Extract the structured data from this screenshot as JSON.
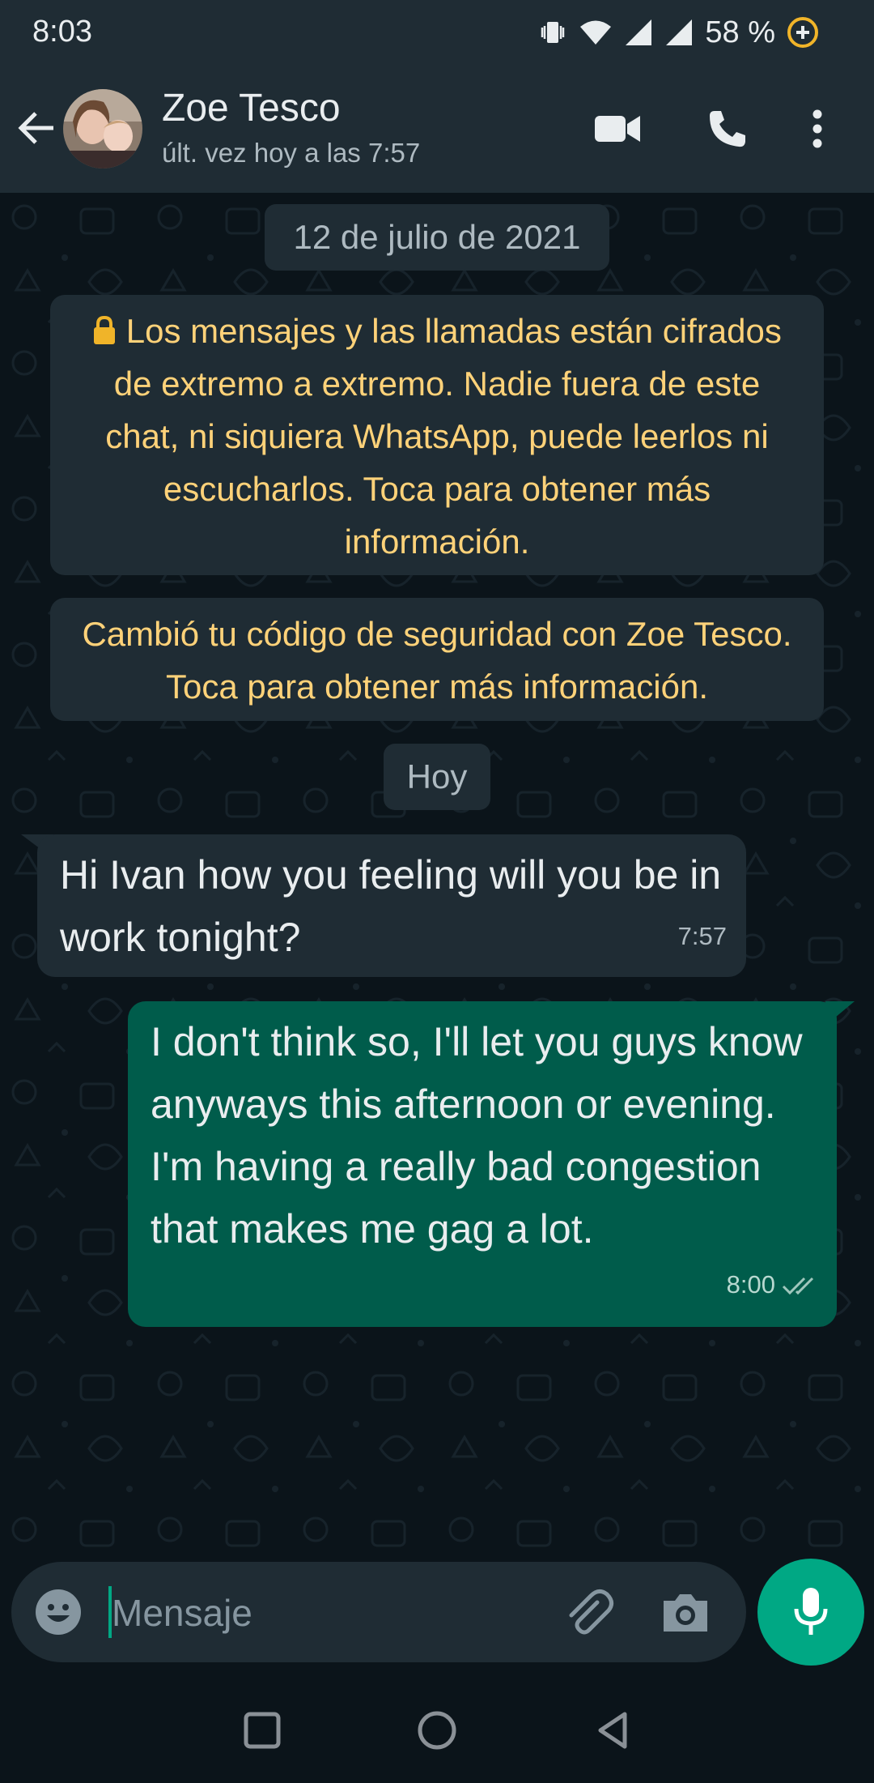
{
  "status_bar": {
    "time": "8:03",
    "battery_percent": "58 %",
    "icons": [
      "vibrate-icon",
      "wifi-icon",
      "signal-icon",
      "signal-icon",
      "battery-saver-icon"
    ]
  },
  "header": {
    "contact_name": "Zoe Tesco",
    "last_seen": "últ. vez hoy a las 7:57",
    "icons": [
      "back-arrow-icon",
      "video-call-icon",
      "phone-call-icon",
      "more-options-icon"
    ]
  },
  "chat": {
    "date_chip_1": "12 de julio de 2021",
    "encryption_notice": {
      "icon": "lock-icon",
      "text": "Los mensajes y las llamadas están cifrados de extremo a extremo. Nadie fuera de este chat, ni siquiera WhatsApp, puede leerlos ni escucharlos. Toca para obtener más información."
    },
    "security_notice": "Cambió tu código de seguridad con Zoe Tesco. Toca para obtener más información.",
    "date_chip_2": "Hoy",
    "messages": [
      {
        "direction": "incoming",
        "text": "Hi Ivan how you feeling will you be in work tonight?",
        "time": "7:57"
      },
      {
        "direction": "outgoing",
        "text": "I don't think so, I'll let you guys know anyways this afternoon or evening. I'm having a really bad congestion that makes me gag a lot.",
        "time": "8:00",
        "status_icon": "double-check-icon"
      }
    ]
  },
  "composer": {
    "placeholder": "Mensaje",
    "icons": [
      "emoji-icon",
      "attach-icon",
      "camera-icon",
      "mic-icon"
    ]
  },
  "colors": {
    "header_bg": "#1f2c34",
    "chat_bg": "#0b141a",
    "incoming_bubble": "#1f2c34",
    "outgoing_bubble": "#005c4b",
    "accent": "#00a884",
    "system_text": "#ffd279"
  }
}
